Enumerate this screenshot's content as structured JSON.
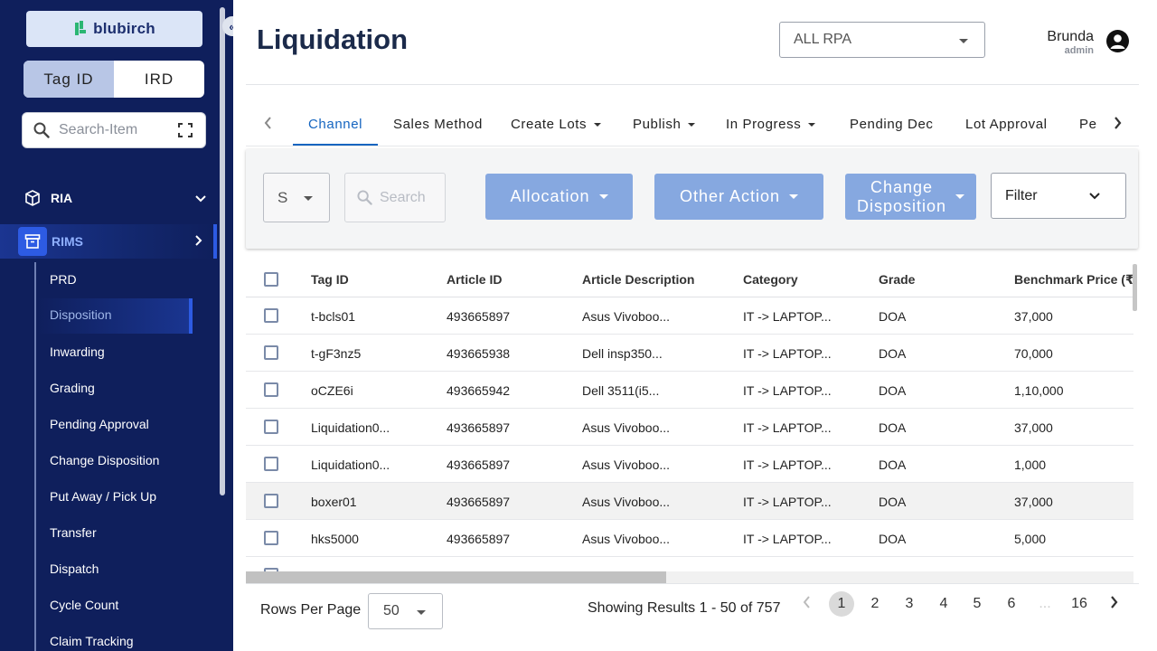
{
  "sidebar": {
    "logo_text": "blubirch",
    "segments": [
      "Tag ID",
      "IRD"
    ],
    "search_placeholder": "Search-Item",
    "groups": {
      "ria": "RIA",
      "rims": "RIMS"
    },
    "items": [
      "PRD",
      "Disposition",
      "Inwarding",
      "Grading",
      "Pending Approval",
      "Change Disposition",
      "Put Away / Pick Up",
      "Transfer",
      "Dispatch",
      "Cycle Count",
      "Claim Tracking"
    ],
    "active_item": "Disposition"
  },
  "header": {
    "title": "Liquidation",
    "rpa_select": "ALL RPA",
    "user_name": "Brunda",
    "user_role": "admin"
  },
  "tabs": [
    "Channel",
    "Sales Method",
    "Create Lots",
    "Publish",
    "In Progress",
    "Pending Dec",
    "Lot Approval",
    "Pe"
  ],
  "active_tab": "Channel",
  "actions": {
    "small_select": "S",
    "search_placeholder": "Search",
    "allocation": "Allocation",
    "other_action": "Other Action",
    "change_disposition_1": "Change",
    "change_disposition_2": "Disposition",
    "filter": "Filter"
  },
  "table": {
    "columns": [
      "Tag ID",
      "Article ID",
      "Article Description",
      "Category",
      "Grade",
      "Benchmark Price (₹"
    ],
    "rows": [
      [
        "t-bcls01",
        "493665897",
        "Asus Vivoboo...",
        "IT -> LAPTOP...",
        "DOA",
        "37,000"
      ],
      [
        "t-gF3nz5",
        "493665938",
        "Dell insp350...",
        "IT -> LAPTOP...",
        "DOA",
        "70,000"
      ],
      [
        "oCZE6i",
        "493665942",
        "Dell 3511(i5...",
        "IT -> LAPTOP...",
        "DOA",
        "1,10,000"
      ],
      [
        "Liquidation0...",
        "493665897",
        "Asus Vivoboo...",
        "IT -> LAPTOP...",
        "DOA",
        "37,000"
      ],
      [
        "Liquidation0...",
        "493665897",
        "Asus Vivoboo...",
        "IT -> LAPTOP...",
        "DOA",
        "1,000"
      ],
      [
        "boxer01",
        "493665897",
        "Asus Vivoboo...",
        "IT -> LAPTOP...",
        "DOA",
        "37,000"
      ],
      [
        "hks5000",
        "493665897",
        "Asus Vivoboo...",
        "IT -> LAPTOP...",
        "DOA",
        "5,000"
      ]
    ]
  },
  "footer": {
    "rows_per_page_label": "Rows Per Page",
    "rows_per_page_value": "50",
    "showing": "Showing Results 1 - 50 of 757",
    "pages": [
      "1",
      "2",
      "3",
      "4",
      "5",
      "6",
      "...",
      "16"
    ],
    "current_page": "1"
  },
  "colors": {
    "sidebar_bg": "#0f1f5c",
    "accent": "#2d5be3",
    "action_button": "#86a8e0",
    "title": "#1b2a4a",
    "tab_active": "#1565c0"
  }
}
